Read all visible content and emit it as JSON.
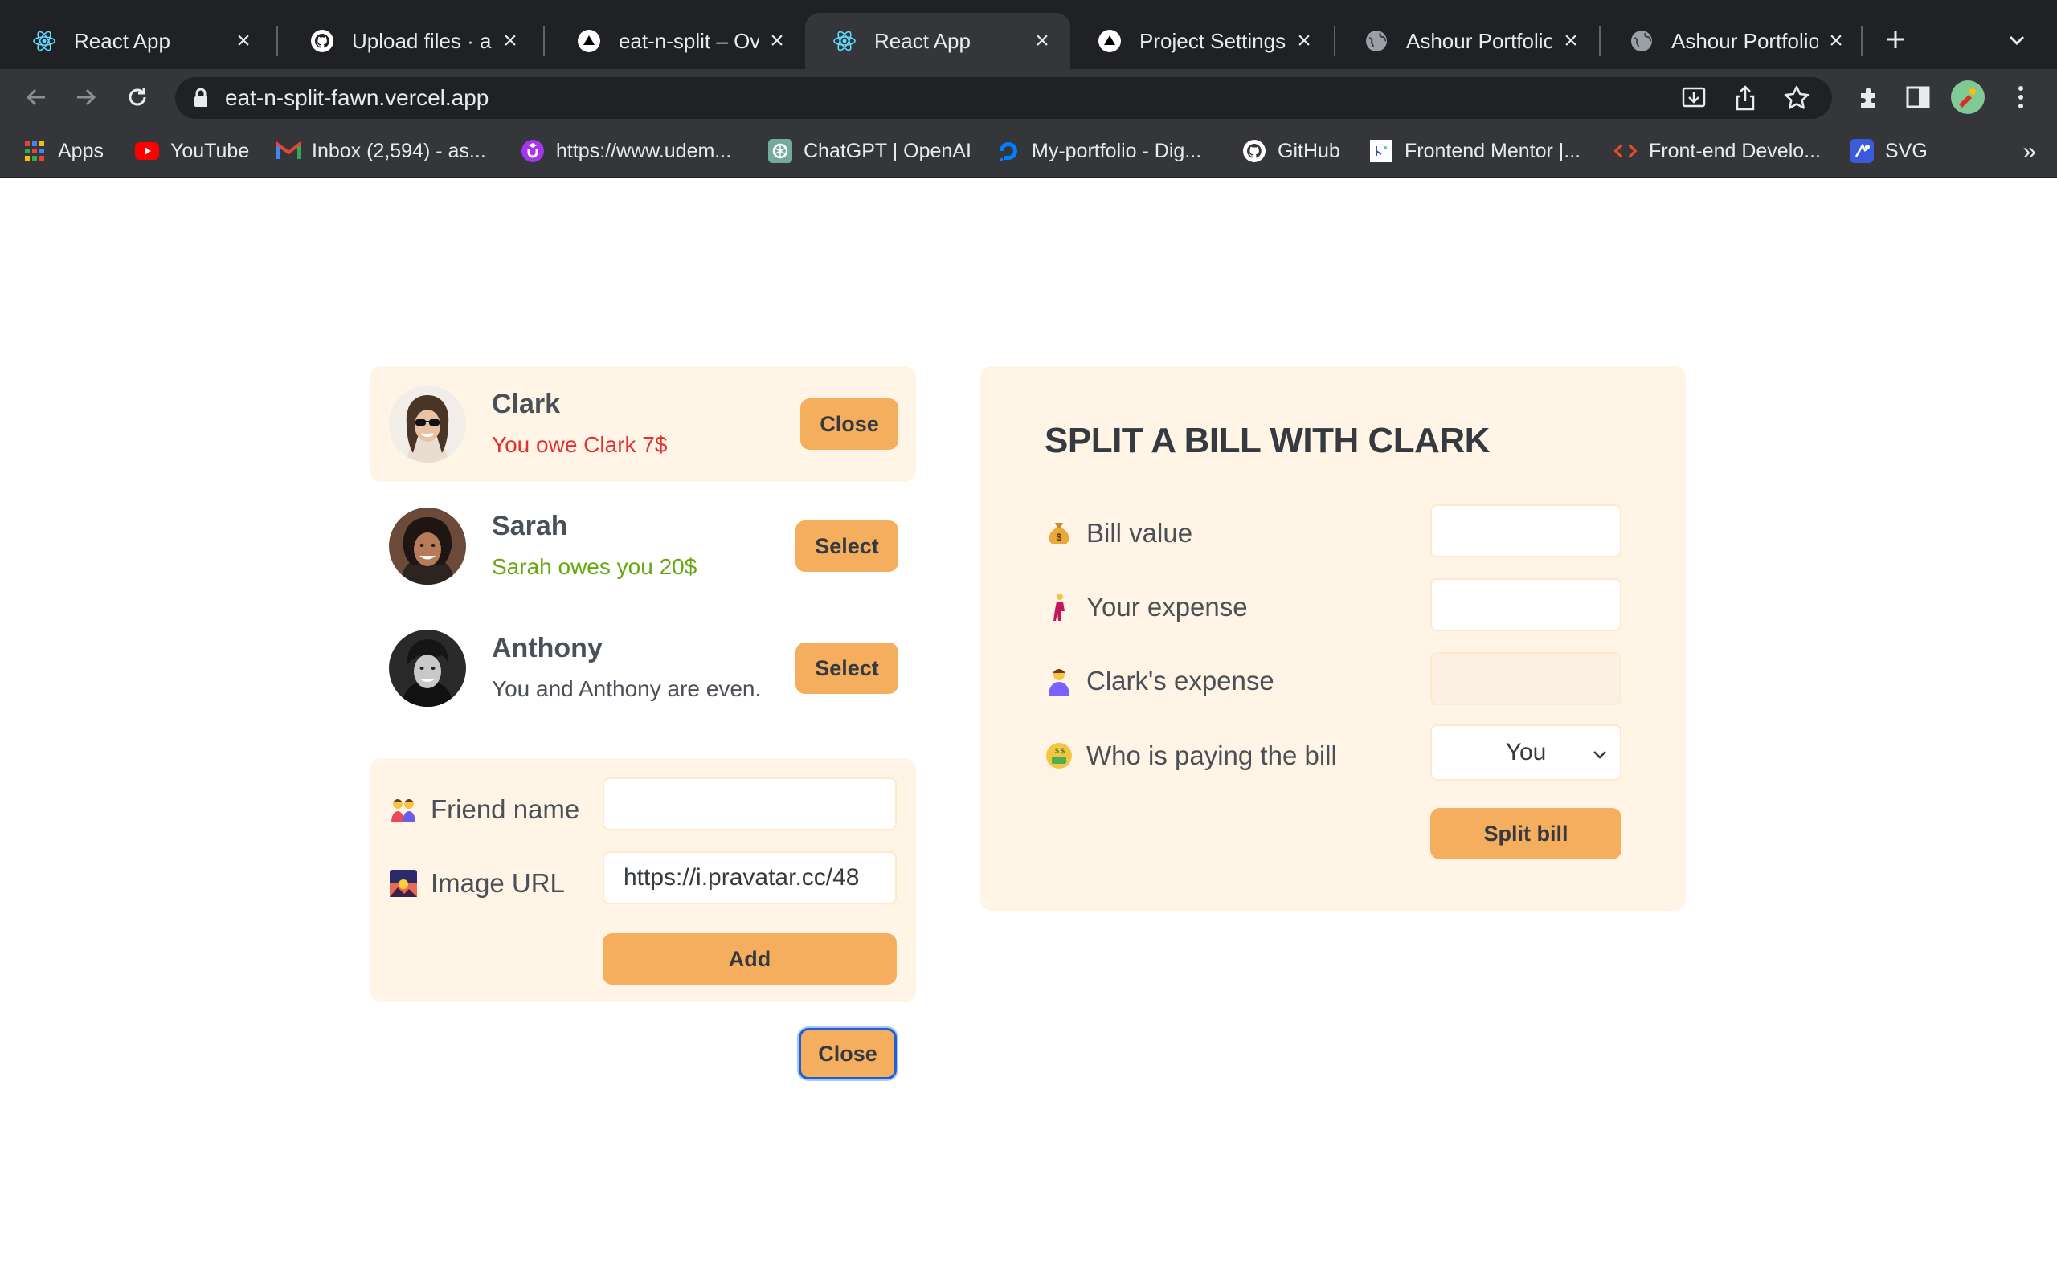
{
  "browser": {
    "tabs": [
      {
        "title": "React App",
        "icon": "react-icon"
      },
      {
        "title": "Upload files · ashour",
        "icon": "github-icon"
      },
      {
        "title": "eat-n-split – Overview",
        "icon": "vercel-icon"
      },
      {
        "title": "React App",
        "icon": "react-icon",
        "active": true
      },
      {
        "title": "Project Settings – ",
        "icon": "vercel-icon"
      },
      {
        "title": "Ashour Portfolio Website",
        "icon": "globe-icon"
      },
      {
        "title": "Ashour Portfolio Website",
        "icon": "globe-icon"
      }
    ],
    "url": "eat-n-split-fawn.vercel.app",
    "bookmarks": [
      {
        "label": "Apps",
        "icon": "apps-grid-icon"
      },
      {
        "label": "YouTube",
        "icon": "youtube-icon"
      },
      {
        "label": "Inbox (2,594) - as...",
        "icon": "gmail-icon"
      },
      {
        "label": "https://www.udem...",
        "icon": "udemy-icon"
      },
      {
        "label": "ChatGPT | OpenAI",
        "icon": "openai-icon"
      },
      {
        "label": "My-portfolio - Dig...",
        "icon": "digitalocean-icon"
      },
      {
        "label": "GitHub",
        "icon": "github-icon"
      },
      {
        "label": "Frontend Mentor |...",
        "icon": "frontend-mentor-icon"
      },
      {
        "label": "Front-end Develo...",
        "icon": "code-icon"
      },
      {
        "label": "SVG",
        "icon": "svg-icon"
      }
    ],
    "more_bookmarks": "»"
  },
  "friends": [
    {
      "name": "Clark",
      "balance": "You owe Clark 7$",
      "status": "owe",
      "button": "Close",
      "selected": true
    },
    {
      "name": "Sarah",
      "balance": "Sarah owes you 20$",
      "status": "owed",
      "button": "Select",
      "selected": false
    },
    {
      "name": "Anthony",
      "balance": "You and Anthony are even.",
      "status": "even",
      "button": "Select",
      "selected": false
    }
  ],
  "add_friend_form": {
    "name_emoji": "👫",
    "name_label": "Friend name",
    "name_value": "",
    "image_emoji": "🌄",
    "image_label": "Image URL",
    "image_value": "https://i.pravatar.cc/48",
    "submit_label": "Add"
  },
  "close_add_button": "Close",
  "split_form": {
    "title": "SPLIT A BILL WITH CLARK",
    "bill_emoji": "💰",
    "bill_label": "Bill value",
    "bill_value": "",
    "your_emoji": "🧍‍♀️",
    "your_label": "Your expense",
    "your_value": "",
    "friend_emoji": "👫",
    "friend_label": "Clark's expense",
    "friend_value": "",
    "payer_emoji": "🤑",
    "payer_label": "Who is paying the bill",
    "payer_value": "You",
    "submit_label": "Split bill"
  },
  "colors": {
    "accent": "#f5ad5e",
    "panel": "#fff4e6",
    "owe": "#e03131",
    "owed": "#66a80f"
  }
}
